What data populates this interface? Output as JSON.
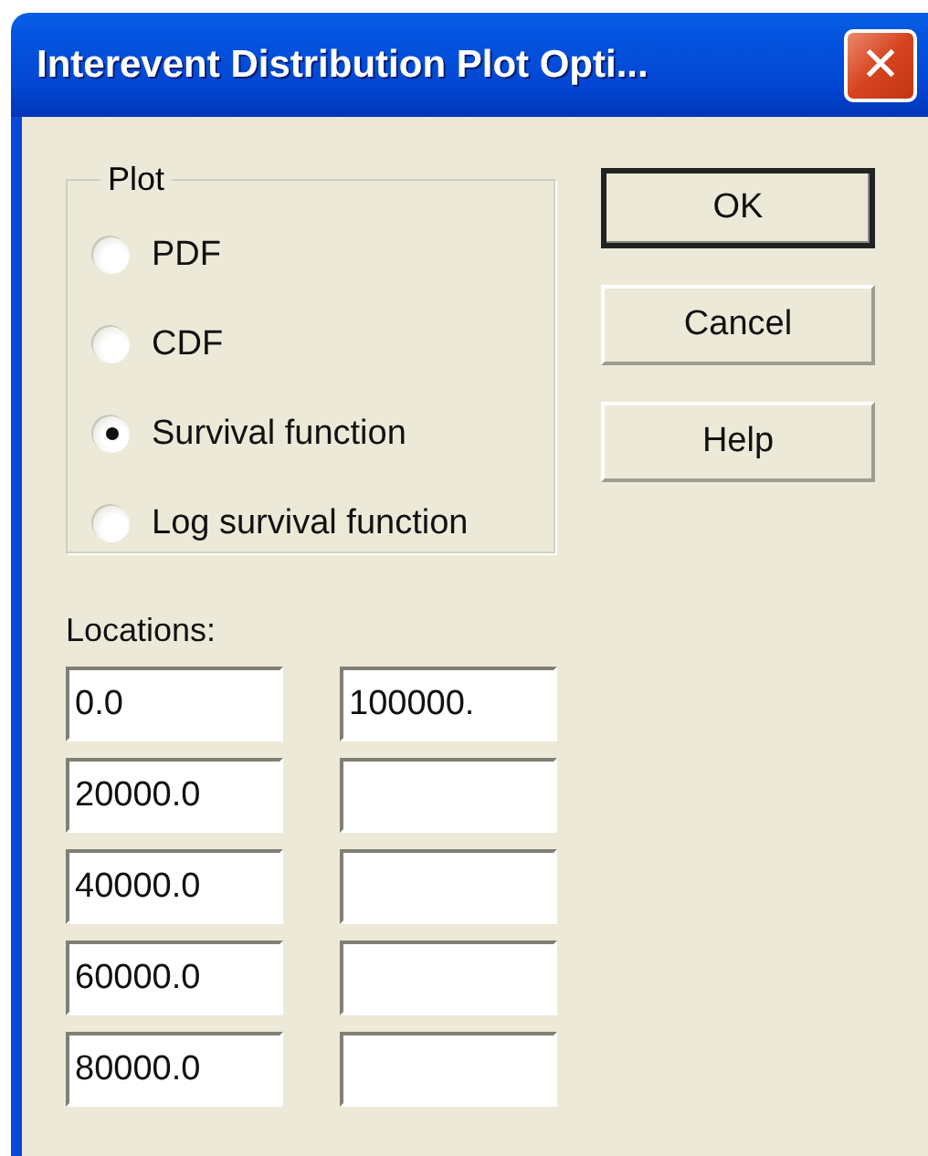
{
  "window": {
    "title": "Interevent Distribution Plot Opti...",
    "close": "✕"
  },
  "plot": {
    "label": "Plot",
    "options": [
      {
        "label": "PDF",
        "selected": false
      },
      {
        "label": "CDF",
        "selected": false
      },
      {
        "label": "Survival function",
        "selected": true
      },
      {
        "label": "Log survival function",
        "selected": false
      }
    ]
  },
  "buttons": [
    {
      "label": "OK",
      "default": true
    },
    {
      "label": "Cancel",
      "default": false
    },
    {
      "label": "Help",
      "default": false
    }
  ],
  "locations": {
    "label": "Locations:",
    "rows": [
      {
        "value_1": "0.0",
        "value_2": "100000."
      },
      {
        "value_1": "20000.0"
      },
      {
        "value_1": "40000.0"
      },
      {
        "value_1": "60000.0"
      },
      {
        "value_1": "80000.0"
      }
    ]
  }
}
